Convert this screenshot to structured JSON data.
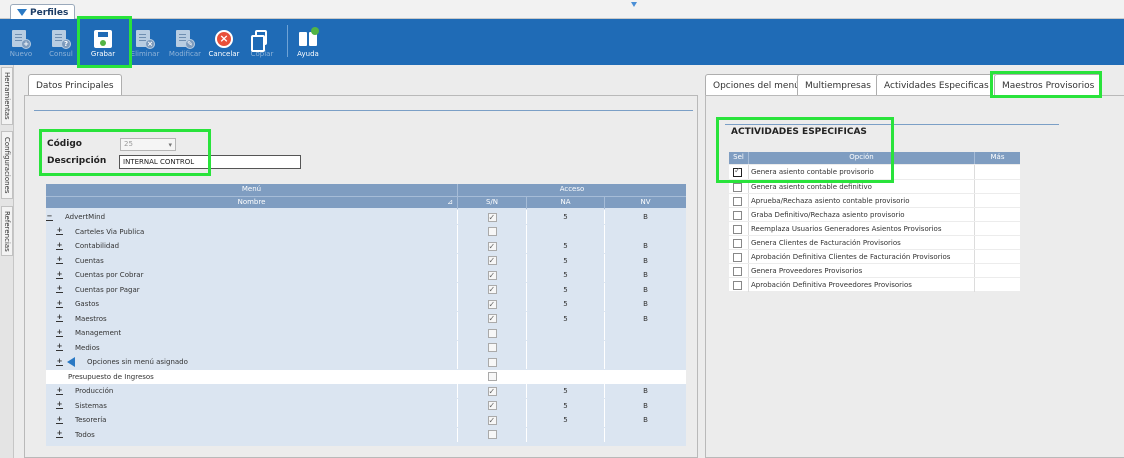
{
  "window": {
    "tab_title": "Perfiles"
  },
  "toolbar": {
    "buttons": [
      {
        "label": "Nuevo",
        "icon": "new-doc-icon",
        "enabled": false
      },
      {
        "label": "Consul",
        "icon": "query-doc-icon",
        "enabled": false
      },
      {
        "label": "Grabar",
        "icon": "save-icon",
        "enabled": true
      },
      {
        "label": "Eliminar",
        "icon": "delete-doc-icon",
        "enabled": false
      },
      {
        "label": "Modificar",
        "icon": "edit-doc-icon",
        "enabled": false
      },
      {
        "label": "Cancelar",
        "icon": "cancel-icon",
        "enabled": true
      },
      {
        "label": "Copiar",
        "icon": "copy-icon",
        "enabled": false
      },
      {
        "label": "Ayuda",
        "icon": "help-book-icon",
        "enabled": true
      }
    ]
  },
  "side_tabs": [
    "Herramientas",
    "Configuraciones",
    "Referencias"
  ],
  "left_tabs": [
    "Datos Principales"
  ],
  "form": {
    "codigo_label": "Código",
    "codigo_value": "25",
    "descripcion_label": "Descripción",
    "descripcion_value": "INTERNAL CONTROL"
  },
  "menu_grid": {
    "group_headers": {
      "menu": "Menú",
      "acceso": "Acceso"
    },
    "columns": {
      "nombre": "Nombre",
      "sn": "S/N",
      "na": "NA",
      "nv": "NV"
    },
    "sort_glyph": "⊿",
    "rows": [
      {
        "name": "AdvertMind",
        "level": 0,
        "expander": "−",
        "sn": true,
        "na": "5",
        "nv": "B"
      },
      {
        "name": "Carteles Via Publica",
        "level": 1,
        "expander": "+",
        "sn": false,
        "na": "",
        "nv": ""
      },
      {
        "name": "Contabilidad",
        "level": 1,
        "expander": "+",
        "sn": true,
        "na": "5",
        "nv": "B"
      },
      {
        "name": "Cuentas",
        "level": 1,
        "expander": "+",
        "sn": true,
        "na": "5",
        "nv": "B"
      },
      {
        "name": "Cuentas por Cobrar",
        "level": 1,
        "expander": "+",
        "sn": true,
        "na": "5",
        "nv": "B"
      },
      {
        "name": "Cuentas por Pagar",
        "level": 1,
        "expander": "+",
        "sn": true,
        "na": "5",
        "nv": "B"
      },
      {
        "name": "Gastos",
        "level": 1,
        "expander": "+",
        "sn": true,
        "na": "5",
        "nv": "B"
      },
      {
        "name": "Maestros",
        "level": 1,
        "expander": "+",
        "sn": true,
        "na": "5",
        "nv": "B"
      },
      {
        "name": "Management",
        "level": 1,
        "expander": "+",
        "sn": false,
        "na": "",
        "nv": ""
      },
      {
        "name": "Medios",
        "level": 1,
        "expander": "+",
        "sn": false,
        "na": "",
        "nv": ""
      },
      {
        "name": "Opciones sin menú asignado",
        "level": 1,
        "expander": "+",
        "sn": false,
        "na": "",
        "nv": "",
        "icon": "arrow-pointer-icon"
      },
      {
        "name": "Presupuesto de Ingresos",
        "level": 2,
        "expander": "",
        "sn": false,
        "na": "",
        "nv": "",
        "selected": true
      },
      {
        "name": "Producción",
        "level": 1,
        "expander": "+",
        "sn": true,
        "na": "5",
        "nv": "B"
      },
      {
        "name": "Sistemas",
        "level": 1,
        "expander": "+",
        "sn": true,
        "na": "5",
        "nv": "B"
      },
      {
        "name": "Tesorería",
        "level": 1,
        "expander": "+",
        "sn": true,
        "na": "5",
        "nv": "B"
      },
      {
        "name": "Todos",
        "level": 1,
        "expander": "+",
        "sn": false,
        "na": "",
        "nv": ""
      }
    ]
  },
  "right_tabs": [
    "Opciones del menú",
    "Multiempresas",
    "Actividades Especificas",
    "Maestros Provisorios"
  ],
  "active_right_tab": "Maestros Provisorios",
  "actividades": {
    "title": "ACTIVIDADES ESPECIFICAS",
    "columns": {
      "sel": "Sel",
      "opcion": "Opción",
      "mas": "Más"
    },
    "rows": [
      {
        "label": "Genera asiento contable provisorio",
        "checked": true
      },
      {
        "label": "Genera asiento contable definitivo",
        "checked": false
      },
      {
        "label": "Aprueba/Rechaza asiento contable provisorio",
        "checked": false
      },
      {
        "label": "Graba Definitivo/Rechaza asiento provisorio",
        "checked": false
      },
      {
        "label": "Reemplaza Usuarios Generadores Asientos Provisorios",
        "checked": false
      },
      {
        "label": "Genera Clientes de Facturación Provisorios",
        "checked": false
      },
      {
        "label": "Aprobación Definitiva Clientes de Facturación Provisorios",
        "checked": false
      },
      {
        "label": "Genera Proveedores Provisorios",
        "checked": false
      },
      {
        "label": "Aprobación Definitiva Proveedores Provisorios",
        "checked": false
      }
    ]
  },
  "colors": {
    "toolbar_bg": "#1f6bb6",
    "grid_header": "#7f9dc1",
    "grid_row": "#dbe5f1",
    "highlight": "#29e33b"
  }
}
